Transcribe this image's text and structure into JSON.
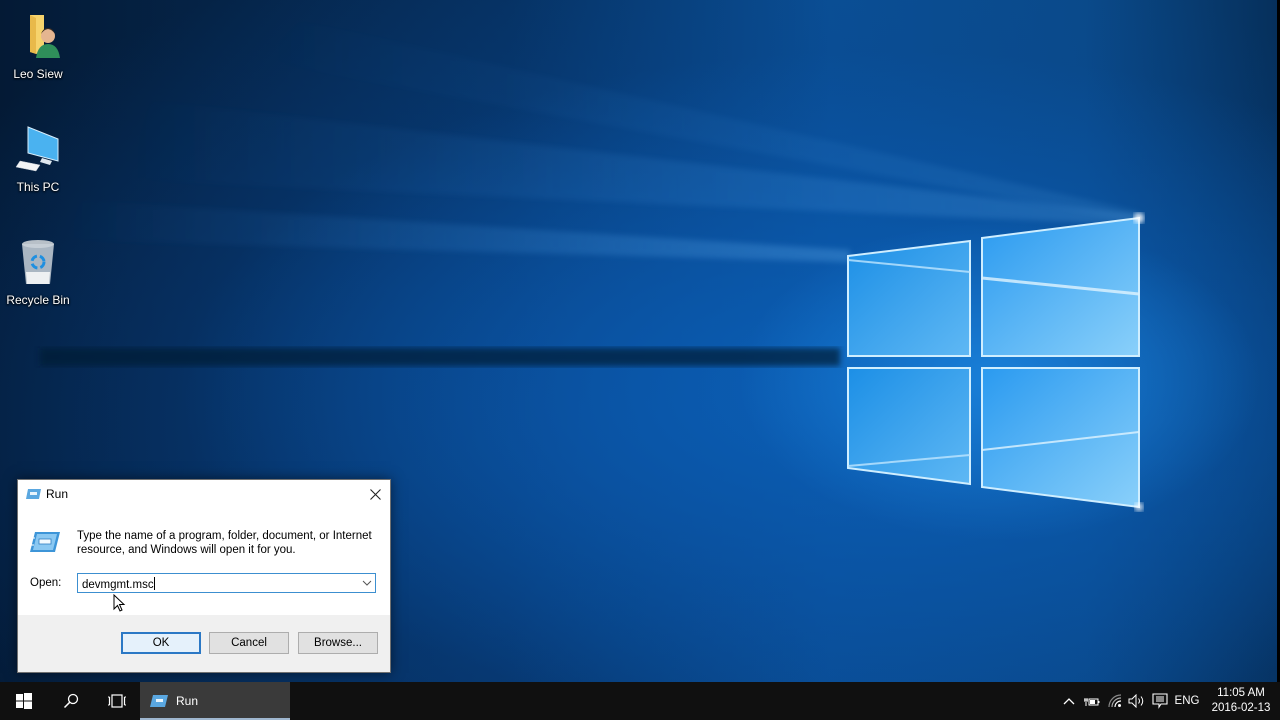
{
  "desktop": {
    "icons": [
      {
        "label": "Leo Siew",
        "icon": "user-folder-icon"
      },
      {
        "label": "This PC",
        "icon": "computer-icon"
      },
      {
        "label": "Recycle Bin",
        "icon": "recycle-bin-icon"
      }
    ]
  },
  "run_dialog": {
    "title": "Run",
    "description": "Type the name of a program, folder, document, or Internet resource, and Windows will open it for you.",
    "open_label": "Open:",
    "input_value": "devmgmt.msc",
    "buttons": {
      "ok": "OK",
      "cancel": "Cancel",
      "browse": "Browse..."
    }
  },
  "taskbar": {
    "running_app": "Run",
    "tray": {
      "language": "ENG",
      "time": "11:05 AM",
      "date": "2016-02-13"
    }
  },
  "colors": {
    "taskbar_bg": "#101010",
    "accent": "#2b78c5",
    "wallpaper_blue": "#0a4f95"
  }
}
